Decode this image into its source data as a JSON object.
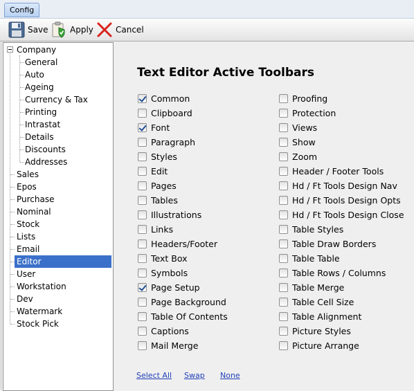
{
  "tab": {
    "label": "Config"
  },
  "toolbar": {
    "save": "Save",
    "apply": "Apply",
    "cancel": "Cancel"
  },
  "tree": {
    "company": "Company",
    "company_children": [
      "General",
      "Auto",
      "Ageing",
      "Currency & Tax",
      "Printing",
      "Intrastat",
      "Details",
      "Discounts",
      "Addresses"
    ],
    "items": [
      "Sales",
      "Epos",
      "Purchase",
      "Nominal",
      "Stock",
      "Lists",
      "Email",
      "Editor",
      "User",
      "Workstation",
      "Dev",
      "Watermark",
      "Stock Pick"
    ],
    "selected": "Editor"
  },
  "content": {
    "title": "Text Editor Active Toolbars",
    "left_column": [
      {
        "label": "Common",
        "checked": true
      },
      {
        "label": "Clipboard",
        "checked": false
      },
      {
        "label": "Font",
        "checked": true
      },
      {
        "label": "Paragraph",
        "checked": false
      },
      {
        "label": "Styles",
        "checked": false
      },
      {
        "label": "Edit",
        "checked": false
      },
      {
        "label": "Pages",
        "checked": false
      },
      {
        "label": "Tables",
        "checked": false
      },
      {
        "label": "Illustrations",
        "checked": false
      },
      {
        "label": "Links",
        "checked": false
      },
      {
        "label": "Headers/Footer",
        "checked": false
      },
      {
        "label": "Text Box",
        "checked": false
      },
      {
        "label": "Symbols",
        "checked": false
      },
      {
        "label": "Page Setup",
        "checked": true
      },
      {
        "label": "Page Background",
        "checked": false
      },
      {
        "label": "Table Of Contents",
        "checked": false
      },
      {
        "label": "Captions",
        "checked": false
      },
      {
        "label": "Mail Merge",
        "checked": false
      }
    ],
    "right_column": [
      {
        "label": "Proofing",
        "checked": false
      },
      {
        "label": "Protection",
        "checked": false
      },
      {
        "label": "Views",
        "checked": false
      },
      {
        "label": "Show",
        "checked": false
      },
      {
        "label": "Zoom",
        "checked": false
      },
      {
        "label": "Header / Footer Tools",
        "checked": false
      },
      {
        "label": "Hd / Ft Tools Design Nav",
        "checked": false
      },
      {
        "label": "Hd / Ft Tools Design Opts",
        "checked": false
      },
      {
        "label": "Hd / Ft Tools Design Close",
        "checked": false
      },
      {
        "label": "Table Styles",
        "checked": false
      },
      {
        "label": "Table Draw Borders",
        "checked": false
      },
      {
        "label": "Table Table",
        "checked": false
      },
      {
        "label": "Table Rows / Columns",
        "checked": false
      },
      {
        "label": "Table Merge",
        "checked": false
      },
      {
        "label": "Table Cell Size",
        "checked": false
      },
      {
        "label": "Table Alignment",
        "checked": false
      },
      {
        "label": "Picture Styles",
        "checked": false
      },
      {
        "label": "Picture Arrange",
        "checked": false
      }
    ],
    "links": {
      "select_all": "Select All",
      "swap": "Swap",
      "none": "None"
    }
  }
}
